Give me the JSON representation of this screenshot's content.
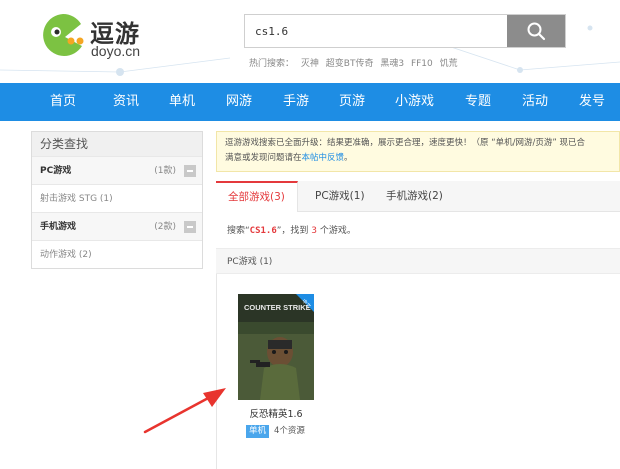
{
  "header": {
    "logo_cn": "逗游",
    "logo_en": "doyo.cn",
    "search_value": "cs1.6",
    "hot_label": "热门搜索：",
    "hot_terms": [
      "灭神",
      "超变BT传奇",
      "黑魂3",
      "FF10",
      "饥荒"
    ]
  },
  "nav": {
    "items": [
      "首页",
      "资讯",
      "单机",
      "网游",
      "手游",
      "页游",
      "小游戏",
      "专题",
      "活动",
      "发号"
    ]
  },
  "sidebar": {
    "title": "分类查找",
    "pc_label": "PC游戏",
    "pc_count": "(1款)",
    "pc_sub": "射击游戏 STG (1)",
    "mobile_label": "手机游戏",
    "mobile_count": "(2款)",
    "mobile_sub": "动作游戏 (2)"
  },
  "notice": {
    "line1": "逗游游戏搜索已全面升级：结果更准确，展示更合理，速度更快！（原 “单机/网游/页游” 现已合",
    "line2_prefix": "满意或发现问题请在",
    "line2_link": "本帖中反馈",
    "line2_suffix": "。"
  },
  "tabs": [
    "全部游戏(3)",
    "PC游戏(1)",
    "手机游戏(2)"
  ],
  "result": {
    "prefix": "搜索“",
    "keyword": "CS1.6",
    "middle": "”，找到 ",
    "count": "3",
    "suffix": " 个游戏。"
  },
  "section": {
    "title": "PC游戏 (1)"
  },
  "game": {
    "name": "反恐精英1.6",
    "tag": "单机",
    "resources": "4个资源",
    "cover_title": "COUNTER STRIKE",
    "cover_badge": "中文"
  },
  "colors": {
    "nav_bg": "#1e8de4",
    "accent_red": "#e4393c",
    "tag_blue": "#4aa6ec",
    "arrow": "#e8342e"
  }
}
